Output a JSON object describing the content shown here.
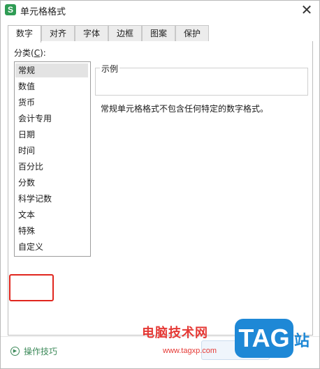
{
  "window": {
    "title": "单元格格式",
    "app_icon_letter": "S",
    "close_glyph": "✕"
  },
  "tabs": [
    "数字",
    "对齐",
    "字体",
    "边框",
    "图案",
    "保护"
  ],
  "active_tab": "数字",
  "category": {
    "label_prefix": "分类(",
    "label_key": "C",
    "label_suffix": "):",
    "items": [
      "常规",
      "数值",
      "货币",
      "会计专用",
      "日期",
      "时间",
      "百分比",
      "分数",
      "科学记数",
      "文本",
      "特殊",
      "自定义"
    ],
    "selected": "常规"
  },
  "sample": {
    "title": "示例"
  },
  "description": "常规单元格格式不包含任何特定的数字格式。",
  "footer": {
    "tips_label": "操作技巧"
  },
  "watermark": {
    "line1": "电脑技术网",
    "url": "www.tagxp.com",
    "badge": "TAG",
    "suffix": "站"
  },
  "colors": {
    "highlight": "#e0261e",
    "accent_green": "#2f9c54",
    "watermark_red": "#e53935",
    "watermark_blue": "#1e88d6"
  }
}
